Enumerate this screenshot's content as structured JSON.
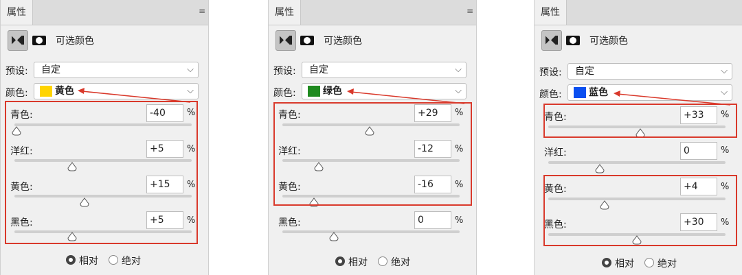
{
  "colors": {
    "red_annotation": "#d9392b"
  },
  "panels": [
    {
      "tab": "属性",
      "title": "可选颜色",
      "preset_label": "预设:",
      "preset_value": "自定",
      "color_label": "颜色:",
      "color_value": "黄色",
      "swatch": "#ffd400",
      "sliders": [
        {
          "label": "青色:",
          "value": "-40",
          "unit": "%",
          "pos": -40
        },
        {
          "label": "洋红:",
          "value": "+5",
          "unit": "%",
          "pos": 5
        },
        {
          "label": "黄色:",
          "value": "+15",
          "unit": "%",
          "pos": 15
        },
        {
          "label": "黑色:",
          "value": "+5",
          "unit": "%",
          "pos": 5
        }
      ],
      "radio_relative": "相对",
      "radio_absolute": "绝对",
      "selected": "relative"
    },
    {
      "tab": "属性",
      "title": "可选颜色",
      "preset_label": "预设:",
      "preset_value": "自定",
      "color_label": "颜色:",
      "color_value": "绿色",
      "swatch": "#1f8a1f",
      "sliders": [
        {
          "label": "青色:",
          "value": "+29",
          "unit": "%",
          "pos": 29
        },
        {
          "label": "洋红:",
          "value": "-12",
          "unit": "%",
          "pos": -12
        },
        {
          "label": "黄色:",
          "value": "-16",
          "unit": "%",
          "pos": -16
        },
        {
          "label": "黑色:",
          "value": "0",
          "unit": "%",
          "pos": 0
        }
      ],
      "radio_relative": "相对",
      "radio_absolute": "绝对",
      "selected": "relative"
    },
    {
      "tab": "属性",
      "title": "可选颜色",
      "preset_label": "预设:",
      "preset_value": "自定",
      "color_label": "颜色:",
      "color_value": "蓝色",
      "swatch": "#0b4ff0",
      "sliders": [
        {
          "label": "青色:",
          "value": "+33",
          "unit": "%",
          "pos": 33
        },
        {
          "label": "洋红:",
          "value": "0",
          "unit": "%",
          "pos": 0
        },
        {
          "label": "黄色:",
          "value": "+4",
          "unit": "%",
          "pos": 4
        },
        {
          "label": "黑色:",
          "value": "+30",
          "unit": "%",
          "pos": 30
        }
      ],
      "radio_relative": "相对",
      "radio_absolute": "绝对",
      "selected": "relative"
    }
  ]
}
